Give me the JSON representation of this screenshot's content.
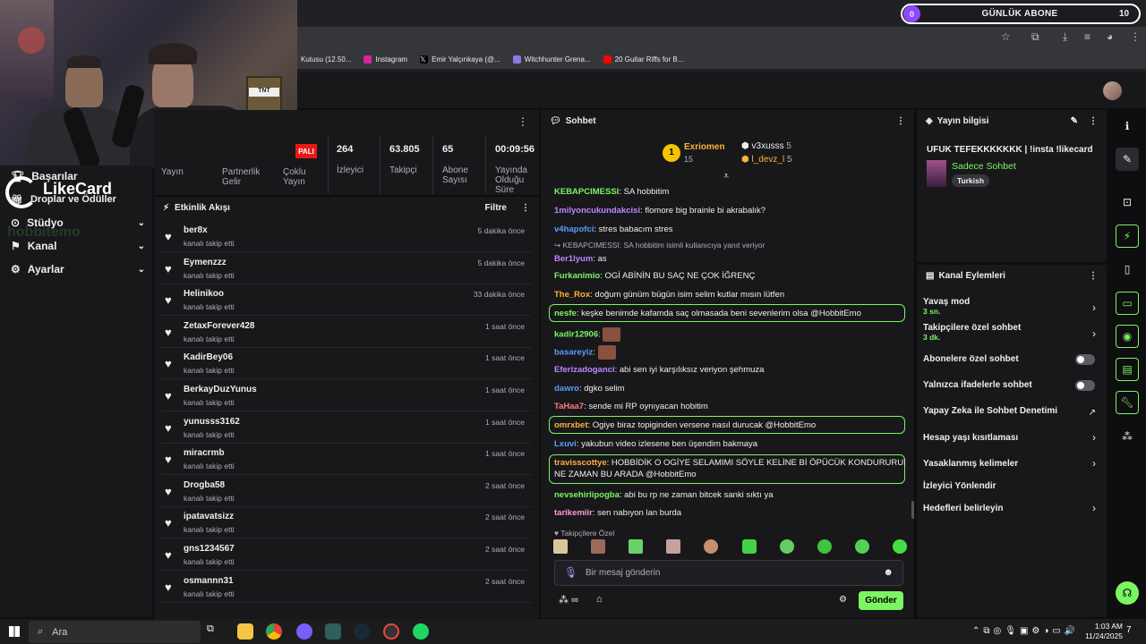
{
  "browser": {
    "bookmarks": [
      {
        "label": "Kutusu (12.50...",
        "color": "#aaaaaa"
      },
      {
        "label": "Instagram",
        "color": "#d6249f"
      },
      {
        "label": "Emir Yalçınkaya (@...",
        "color": "#ffffff"
      },
      {
        "label": "Witchhunter Grena...",
        "color": "#8c7ae6"
      },
      {
        "label": "20 Guitar Riffs for B...",
        "color": "#ff0000"
      }
    ]
  },
  "goal": {
    "current": "0",
    "label": "GÜNLÜK ABONE",
    "target": "10"
  },
  "overlay": {
    "brand": "LikeCard",
    "watermark": "hobbitemo"
  },
  "sidebar": {
    "items": [
      {
        "label": "Başarılar"
      },
      {
        "label": "Droplar ve Ödüller"
      },
      {
        "label": "Stüdyo"
      },
      {
        "label": "Kanal"
      },
      {
        "label": "Ayarlar"
      }
    ]
  },
  "stats": {
    "badge": "PALI",
    "labels": [
      "Yayın",
      "Partnerlik Gelir",
      "Çoklu Yayın"
    ],
    "items": [
      {
        "value": "264",
        "label": "İzleyici"
      },
      {
        "value": "63.805",
        "label": "Takipçi"
      },
      {
        "value": "65",
        "label": "Abone Sayısı"
      },
      {
        "value": "00:09:56",
        "label": "Yayında Olduğu Süre"
      }
    ]
  },
  "activity": {
    "title": "Etkinlik Akışı",
    "filter": "Filtre",
    "events": [
      {
        "user": "ber8x",
        "desc": "kanalı takip etti",
        "time": "5 dakika önce"
      },
      {
        "user": "Eymenzzz",
        "desc": "kanalı takip etti",
        "time": "5 dakika önce"
      },
      {
        "user": "Helinikoo",
        "desc": "kanalı takip etti",
        "time": "33 dakika önce"
      },
      {
        "user": "ZetaxForever428",
        "desc": "kanalı takip etti",
        "time": "1 saat önce"
      },
      {
        "user": "KadirBey06",
        "desc": "kanalı takip etti",
        "time": "1 saat önce"
      },
      {
        "user": "BerkayDuzYunus",
        "desc": "kanalı takip etti",
        "time": "1 saat önce"
      },
      {
        "user": "yunusss3162",
        "desc": "kanalı takip etti",
        "time": "1 saat önce"
      },
      {
        "user": "miracrmb",
        "desc": "kanalı takip etti",
        "time": "1 saat önce"
      },
      {
        "user": "Drogba58",
        "desc": "kanalı takip etti",
        "time": "2 saat önce"
      },
      {
        "user": "ipatavatsizz",
        "desc": "kanalı takip etti",
        "time": "2 saat önce"
      },
      {
        "user": "gns1234567",
        "desc": "kanalı takip etti",
        "time": "2 saat önce"
      },
      {
        "user": "osmannn31",
        "desc": "kanalı takip etti",
        "time": "2 saat önce"
      }
    ]
  },
  "chat": {
    "title": "Sohbet",
    "leaderboard": {
      "first": {
        "rank": "1",
        "name": "Exriomen",
        "count": "15"
      },
      "others": [
        {
          "name": "v3xusss",
          "count": "5"
        },
        {
          "name": "l_devz_l",
          "count": "5"
        }
      ]
    },
    "messages": [
      {
        "user": "KEBAPCIMESSI",
        "text": "SA hobbitim",
        "color": "#7bf562"
      },
      {
        "user": "1milyoncukundakcisi",
        "text": "flomore big brainle bi akrabalık?",
        "color": "#c086ff"
      },
      {
        "user": "v4hapofci",
        "text": "stres babacım stres",
        "color": "#5b9cff"
      },
      {
        "user": "Ber1lyum",
        "text": "as",
        "color": "#c086ff",
        "reply": "KEBAPCIMESSI: SA hobbitim isimli kullanıcıya yanıt veriyor"
      },
      {
        "user": "Furkanimio",
        "text": "OGİ ABİNİN BU SAÇ NE ÇOK İĞRENÇ",
        "color": "#7bf562"
      },
      {
        "user": "The_Rox",
        "text": "doğum günüm bügün isim selim kutlar mısın lütfen",
        "color": "#ffb13b"
      },
      {
        "user": "nesfe",
        "text": "keşke benimde kafamda saç olmasada beni sevenlerim olsa @HobbitEmo",
        "color": "#7bf562"
      },
      {
        "user": "kadir12906",
        "text": "",
        "color": "#7bf562"
      },
      {
        "user": "basareyiz",
        "text": "",
        "color": "#5b9cff"
      },
      {
        "user": "Eferizadoganci",
        "text": "abi sen iyi karşılıksız veriyon şehmuza",
        "color": "#c086ff"
      },
      {
        "user": "dawro",
        "text": "dgko selim",
        "color": "#5b9cff"
      },
      {
        "user": "TaHaa7",
        "text": "sende mi RP oynıyacan hobitim",
        "color": "#ff7a7a"
      },
      {
        "user": "omrxbet",
        "text": "Ogiye biraz topiginden versene nasıl durucak @HobbitEmo",
        "color": "#ffb13b"
      },
      {
        "user": "Lxuvi",
        "text": "yakubun video izlesene ben üşendim bakmaya",
        "color": "#5b9cff"
      },
      {
        "user": "travisscottye",
        "text": "HOBBİDİK O OGİYE SELAMIMI SÖYLE KELİNE Bİ ÖPÜCÜK KONDURURUM RP",
        "text2": "NE ZAMAN BU ARADA @HobbitEmo",
        "color": "#ffb13b"
      },
      {
        "user": "nevsehirlipogba",
        "text": "abi bu rp ne zaman bitcek sanki sıktı ya",
        "color": "#7bf562"
      },
      {
        "user": "tarikemiir",
        "text": "sen nabıyon lan burda",
        "color": "#ff9ad5"
      }
    ],
    "followers_only": "Takipçilere Özel",
    "input_placeholder": "Bir mesaj gönderin",
    "send_label": "Gönder"
  },
  "stream_info": {
    "title": "Yayın bilgisi",
    "stream_title": "UFUK TEFEKKKKKKK | !insta !likecard",
    "category": "Sadece Sohbet",
    "tag": "Turkish"
  },
  "channel_actions": {
    "title": "Kanal Eylemleri",
    "items": [
      {
        "label": "Yavaş mod",
        "sub": "3 sn."
      },
      {
        "label": "Takipçilere özel sohbet",
        "sub": "3 dk."
      },
      {
        "label": "Abonelere özel sohbet",
        "sub": ""
      },
      {
        "label": "Yalnızca ifadelerle sohbet",
        "sub": ""
      },
      {
        "label": "Yapay Zeka ile Sohbet Denetimi",
        "sub": ""
      },
      {
        "label": "Hesap yaşı kısıtlaması",
        "sub": ""
      },
      {
        "label": "Yasaklanmış kelimeler",
        "sub": ""
      },
      {
        "label": "İzleyici Yönlendir",
        "sub": ""
      },
      {
        "label": "Hedefleri belirleyin",
        "sub": ""
      }
    ]
  },
  "taskbar": {
    "search": "Ara",
    "time": "1:03 AM",
    "date": "11/24/2025",
    "notifications": "7"
  }
}
